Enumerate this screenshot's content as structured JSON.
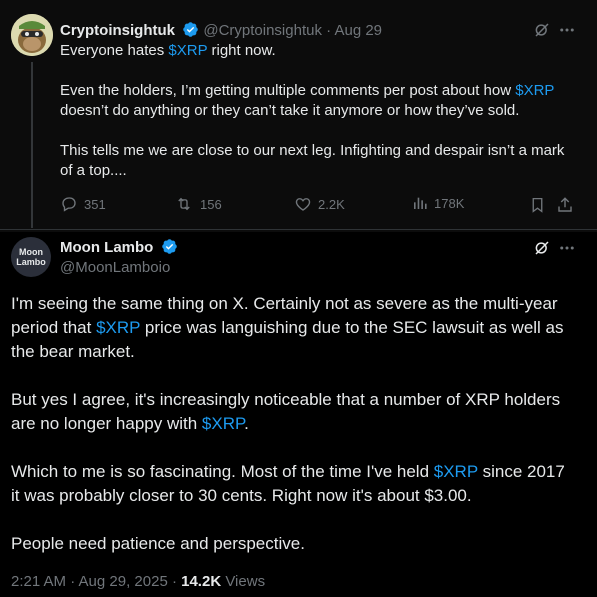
{
  "tweet1": {
    "author_name": "Cryptoinsightuk",
    "author_handle": "@Cryptoinsightuk",
    "separator": "·",
    "date": "Aug 29",
    "line1_pre": "Everyone hates ",
    "line1_tag": "$XRP",
    "line1_post": " right now.",
    "para2_pre": "Even the holders, I’m getting multiple comments per post about how ",
    "para2_tag": "$XRP",
    "para2_line2": "doesn’t do anything or they can’t take it anymore or how they’ve sold.",
    "para3_line1": "This tells me we are close to our next leg. Infighting and despair isn’t a mark",
    "para3_line2": "of a top....",
    "replies": "351",
    "reposts": "156",
    "likes": "2.2K",
    "views": "178K"
  },
  "tweet2": {
    "author_name": "Moon Lambo",
    "author_handle": "@MoonLamboio",
    "avatar_line1": "Moon",
    "avatar_line2": "Lambo",
    "p1_l1": "I'm seeing the same thing on X. Certainly not as severe as the multi-year",
    "p1_l2_pre": "period that ",
    "p1_l2_tag": "$XRP",
    "p1_l2_post": " price was languishing due to the SEC lawsuit as well as",
    "p1_l3": "the bear market.",
    "p2_l1": "But yes I agree, it's increasingly noticeable that a number of XRP holders",
    "p2_l2_pre": "are no longer happy with ",
    "p2_l2_tag": "$XRP",
    "p2_l2_post": ".",
    "p3_l1_pre": "Which to me is so fascinating. Most of the time I've held ",
    "p3_l1_tag": "$XRP",
    "p3_l1_post": " since 2017",
    "p3_l2": "it was probably closer to 30 cents. Right now it's about $3.00.",
    "p4_l1": "People need patience and perspective.",
    "time": "2:21 AM · Aug 29, 2025 · ",
    "views_count": "14.2K",
    "views_label": " Views"
  },
  "colors": {
    "accent": "#1d9bf0",
    "muted": "#71767b",
    "text": "#e7e9ea",
    "background": "#000000"
  },
  "icons": [
    "reply-icon",
    "repost-icon",
    "like-icon",
    "views-icon",
    "bookmark-icon",
    "share-icon",
    "grok-icon",
    "more-icon",
    "verified-icon"
  ]
}
